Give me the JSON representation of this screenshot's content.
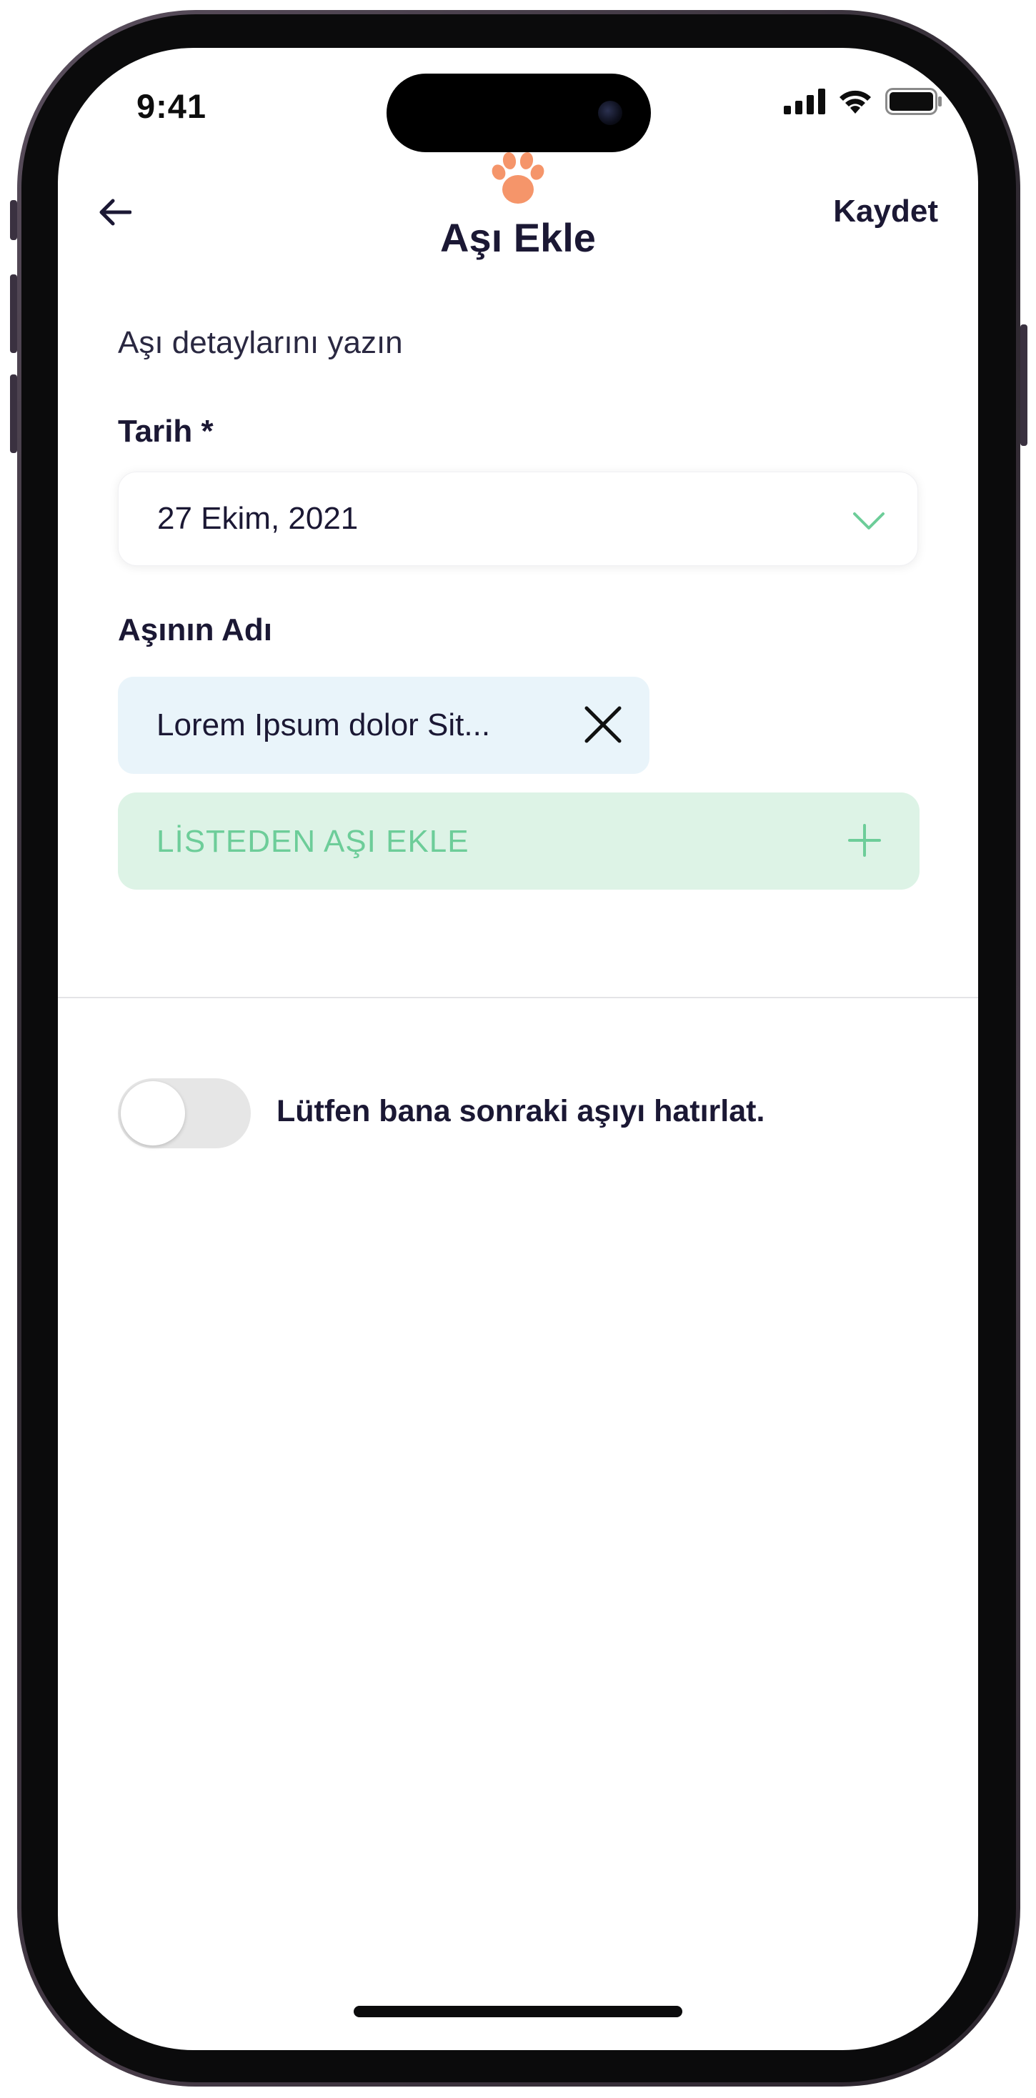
{
  "status_bar": {
    "time": "9:41"
  },
  "header": {
    "title": "Aşı Ekle",
    "save_label": "Kaydet",
    "back_icon": "arrow-left-icon",
    "logo_icon": "paw-icon"
  },
  "form": {
    "subtitle": "Aşı detaylarını yazın",
    "date_label": "Tarih *",
    "date_value": "27 Ekim, 2021",
    "vaccine_name_label": "Aşının Adı",
    "vaccine_chip": "Lorem Ipsum dolor Sit...",
    "add_from_list_label": "LİSTEDEN AŞI EKLE"
  },
  "reminder": {
    "label": "Lütfen bana sonraki aşıyı hatırlat.",
    "enabled": false
  },
  "colors": {
    "accent_green": "#6dcd99",
    "green_bg": "#ddf3e6",
    "chip_bg": "#e9f4fa",
    "text_dark": "#1b1834",
    "paw_orange": "#f5956a"
  }
}
